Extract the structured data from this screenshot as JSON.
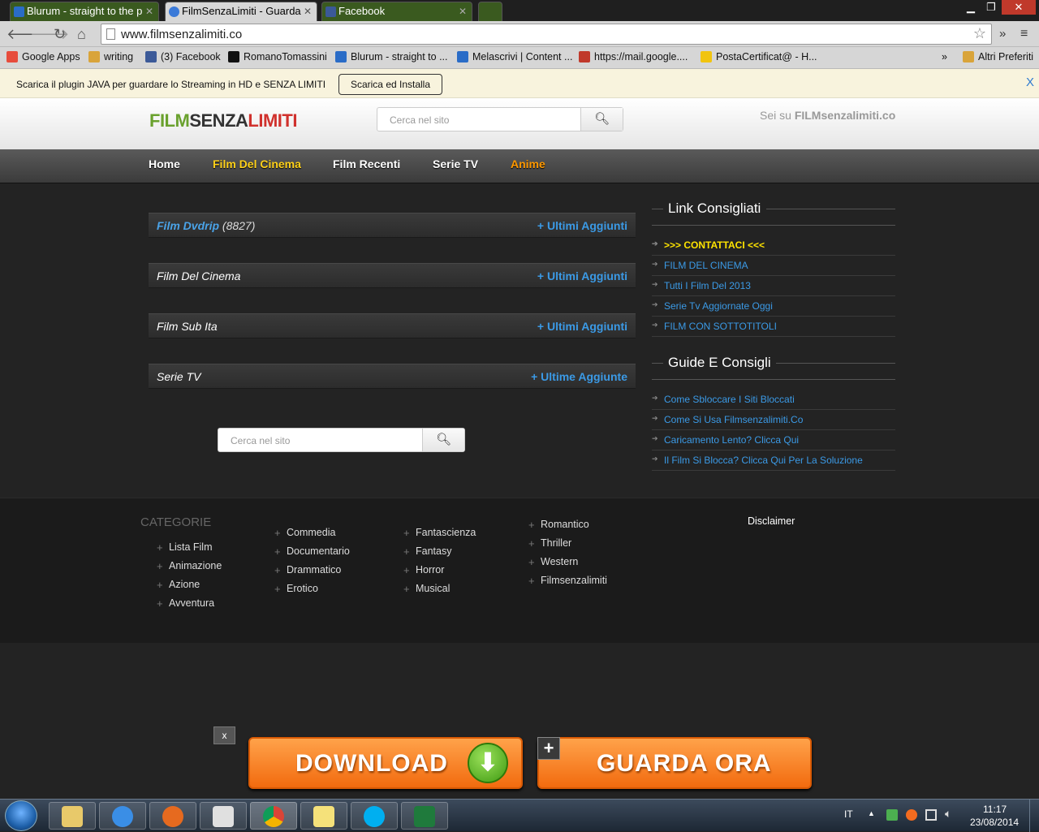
{
  "browser": {
    "tabs": [
      {
        "label": "Blurum - straight to the p",
        "color": "#2a6cc7"
      },
      {
        "label": "FilmSenzaLimiti - Guarda",
        "color": "#3b7ad8"
      },
      {
        "label": "Facebook",
        "color": "#3b5998"
      }
    ],
    "window_controls": {
      "minimize": "▁",
      "restore": "❐",
      "close": "✕"
    },
    "url": "www.filmsenzalimiti.co",
    "bookmarks": [
      {
        "label": "Google Apps",
        "icon": "grid-icon",
        "color": "#e74c3c"
      },
      {
        "label": "writing",
        "icon": "folder-icon",
        "color": "#d9a43a"
      },
      {
        "label": "(3) Facebook",
        "icon": "facebook-icon",
        "color": "#3b5998"
      },
      {
        "label": "RomanoTomassini",
        "icon": "triangle-icon",
        "color": "#111"
      },
      {
        "label": "Blurum - straight to ...",
        "icon": "blurum-icon",
        "color": "#2a6cc7"
      },
      {
        "label": "Melascrivi | Content ...",
        "icon": "melascrivi-icon",
        "color": "#2a6cc7"
      },
      {
        "label": "https://mail.google....",
        "icon": "gmail-icon",
        "color": "#c0392b"
      },
      {
        "label": "PostaCertificat@ - H...",
        "icon": "postacert-icon",
        "color": "#f1c40f"
      }
    ],
    "bookmarks_more": "»",
    "other_bookmarks": "Altri Preferiti"
  },
  "plugin_bar": {
    "message": "Scarica il plugin JAVA per guardare lo Streaming in HD e SENZA LIMITI",
    "button": "Scarica ed Installa",
    "close": "X"
  },
  "site": {
    "logo": {
      "part1": "FILM",
      "part2": "SENZA",
      "part3": "LIMITI"
    },
    "search_placeholder": "Cerca nel sito",
    "seisu_prefix": "Sei su ",
    "seisu_domain": "FILMsenzalimiti.co",
    "menu": [
      {
        "label": "Home",
        "color": "#ffffff"
      },
      {
        "label": "Film Del Cinema",
        "color": "#ffd11a"
      },
      {
        "label": "Film Recenti",
        "color": "#ffffff"
      },
      {
        "label": "Serie TV",
        "color": "#ffffff"
      },
      {
        "label": "Anime",
        "color": "#ff9900"
      }
    ],
    "categories": [
      {
        "title": "Film Dvdrip",
        "count": "(8827)",
        "link": "+ Ultimi Aggiunti"
      },
      {
        "title": "Film Del Cinema",
        "count": "",
        "link": "+ Ultimi Aggiunti"
      },
      {
        "title": "Film Sub Ita",
        "count": "",
        "link": "+ Ultimi Aggiunti"
      },
      {
        "title": "Serie TV",
        "count": "",
        "link": "+ Ultime Aggiunte"
      }
    ],
    "sidebar": {
      "link_title": "Link Consigliati",
      "links": [
        ">>> CONTATTACI <<<",
        "FILM DEL CINEMA",
        "Tutti I Film Del 2013",
        "Serie Tv Aggiornate Oggi",
        "FILM CON SOTTOTITOLI"
      ],
      "guide_title": "Guide E Consigli",
      "guides": [
        "Come Sbloccare I Siti Bloccati",
        "Come Si Usa Filmsenzalimiti.Co",
        "Caricamento Lento? Clicca Qui",
        "Il Film Si Blocca? Clicca Qui Per La Soluzione"
      ]
    },
    "footer": {
      "heading": "CATEGORIE",
      "col1": [
        "Lista Film",
        "Animazione",
        "Azione",
        "Avventura"
      ],
      "col2": [
        "Commedia",
        "Documentario",
        "Drammatico",
        "Erotico"
      ],
      "col3": [
        "Fantascienza",
        "Fantasy",
        "Horror",
        "Musical"
      ],
      "col4": [
        "Romantico",
        "Thriller",
        "Western",
        "Filmsenzalimiti"
      ],
      "disclaimer": "Disclaimer"
    },
    "ad": {
      "close": "x",
      "download": "DOWNLOAD",
      "plus": "+",
      "watch": "GUARDA ORA"
    }
  },
  "taskbar": {
    "lang": "IT",
    "time": "11:17",
    "date": "23/08/2014",
    "apps": [
      {
        "name": "explorer-icon",
        "color": "#e8c96a"
      },
      {
        "name": "ie-icon",
        "color": "#3a8ee6"
      },
      {
        "name": "firefox-icon",
        "color": "#e66a1f"
      },
      {
        "name": "apps-icon",
        "color": "#e0e0e0"
      },
      {
        "name": "chrome-icon",
        "color": "#3cba54"
      },
      {
        "name": "notes-icon",
        "color": "#f5e17a"
      },
      {
        "name": "skype-icon",
        "color": "#00aff0"
      },
      {
        "name": "excel-icon",
        "color": "#1f7a3c"
      }
    ]
  }
}
